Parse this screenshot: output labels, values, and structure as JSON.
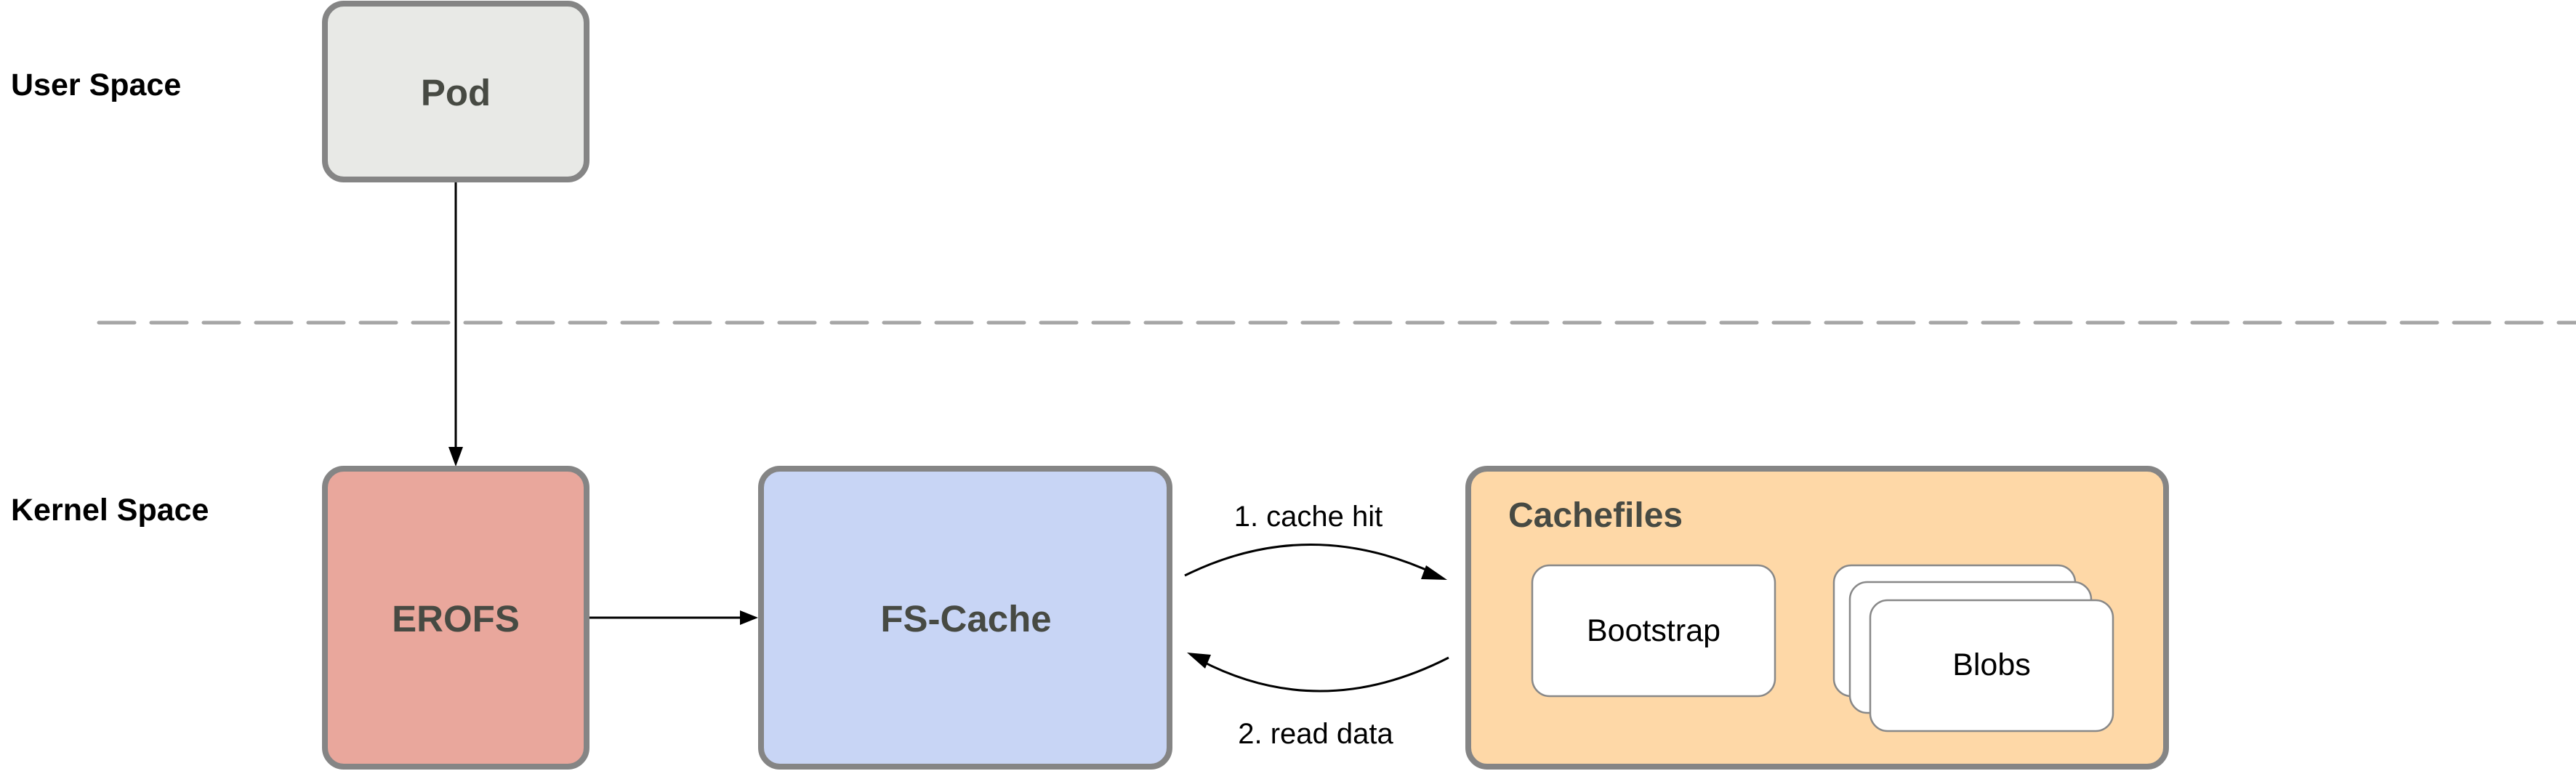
{
  "lanes": {
    "user_space": "User Space",
    "kernel_space": "Kernel Space"
  },
  "nodes": {
    "pod": {
      "label": "Pod",
      "fill": "#e8e9e6"
    },
    "erofs": {
      "label": "EROFS",
      "fill": "#e9a79c"
    },
    "fscache": {
      "label": "FS-Cache",
      "fill": "#c8d5f5"
    },
    "cachefiles": {
      "label": "Cachefiles",
      "fill": "#fed8a7",
      "children": {
        "bootstrap": "Bootstrap",
        "blobs": "Blobs"
      }
    }
  },
  "edges": {
    "pod_to_erofs": {
      "from": "Pod",
      "to": "EROFS"
    },
    "erofs_to_fscache": {
      "from": "EROFS",
      "to": "FS-Cache"
    },
    "cache_hit": {
      "from": "FS-Cache",
      "to": "Cachefiles",
      "label": "1. cache hit"
    },
    "read_data": {
      "from": "Cachefiles",
      "to": "FS-Cache",
      "label": "2. read data"
    }
  },
  "colors": {
    "border": "#858585",
    "text_dark": "#474a43",
    "divider": "#a6a6a6"
  }
}
